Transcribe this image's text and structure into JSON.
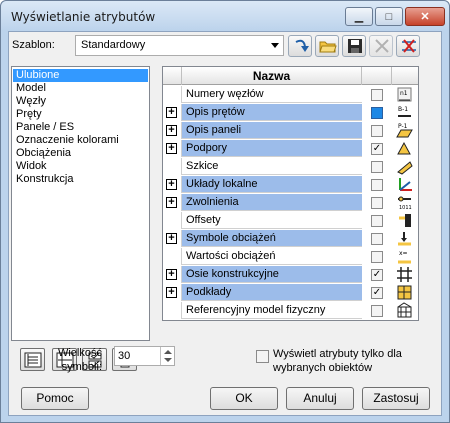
{
  "window": {
    "title": "Wyświetlanie atrybutów"
  },
  "template": {
    "label": "Szablon:",
    "value": "Standardowy"
  },
  "toolbar": {
    "buttons": [
      "reload-icon",
      "open-folder-icon",
      "save-icon",
      "delete-icon",
      "clear-icon"
    ]
  },
  "categories": [
    {
      "label": "Ulubione",
      "selected": true
    },
    {
      "label": "Model",
      "selected": false
    },
    {
      "label": "Węzły",
      "selected": false
    },
    {
      "label": "Pręty",
      "selected": false
    },
    {
      "label": "Panele / ES",
      "selected": false
    },
    {
      "label": "Oznaczenie kolorami",
      "selected": false
    },
    {
      "label": "Obciążenia",
      "selected": false
    },
    {
      "label": "Widok",
      "selected": false
    },
    {
      "label": "Konstrukcja",
      "selected": false
    }
  ],
  "grid": {
    "header": "Nazwa",
    "rows": [
      {
        "name": "Numery węzłów",
        "expandable": false,
        "highlighted": false,
        "checked": false,
        "icon": "node-numbers-icon"
      },
      {
        "name": "Opis prętów",
        "expandable": true,
        "highlighted": true,
        "checked": "partial",
        "icon": "bar-description-icon"
      },
      {
        "name": "Opis paneli",
        "expandable": true,
        "highlighted": true,
        "checked": false,
        "icon": "panel-description-icon"
      },
      {
        "name": "Podpory",
        "expandable": true,
        "highlighted": true,
        "checked": true,
        "icon": "supports-icon"
      },
      {
        "name": "Szkice",
        "expandable": false,
        "highlighted": false,
        "checked": false,
        "icon": "sketches-icon"
      },
      {
        "name": "Układy lokalne",
        "expandable": true,
        "highlighted": true,
        "checked": false,
        "icon": "local-systems-icon"
      },
      {
        "name": "Zwolnienia",
        "expandable": true,
        "highlighted": true,
        "checked": false,
        "icon": "releases-icon"
      },
      {
        "name": "Offsety",
        "expandable": false,
        "highlighted": false,
        "checked": false,
        "icon": "offsets-icon"
      },
      {
        "name": "Symbole obciążeń",
        "expandable": true,
        "highlighted": true,
        "checked": false,
        "icon": "load-symbols-icon"
      },
      {
        "name": "Wartości obciążeń",
        "expandable": false,
        "highlighted": false,
        "checked": false,
        "icon": "load-values-icon"
      },
      {
        "name": "Osie konstrukcyjne",
        "expandable": true,
        "highlighted": true,
        "checked": true,
        "icon": "structural-axes-icon"
      },
      {
        "name": "Podkłady",
        "expandable": true,
        "highlighted": true,
        "checked": true,
        "icon": "underlays-icon"
      },
      {
        "name": "Referencyjny model fizyczny",
        "expandable": false,
        "highlighted": false,
        "checked": false,
        "icon": "physical-model-icon"
      }
    ]
  },
  "symbol_size": {
    "label_line1": "Wielkość",
    "label_line2": "symboli:",
    "value": "30"
  },
  "selected_only": {
    "line1": "Wyświetl atrybuty tylko dla",
    "line2": "wybranych obiektów",
    "checked": false
  },
  "buttons": {
    "help": "Pomoc",
    "ok": "OK",
    "cancel": "Anuluj",
    "apply": "Zastosuj"
  },
  "colors": {
    "selection": "#3399ff",
    "row_highlight": "#9cbcea",
    "frame": "#bcd3ec"
  }
}
